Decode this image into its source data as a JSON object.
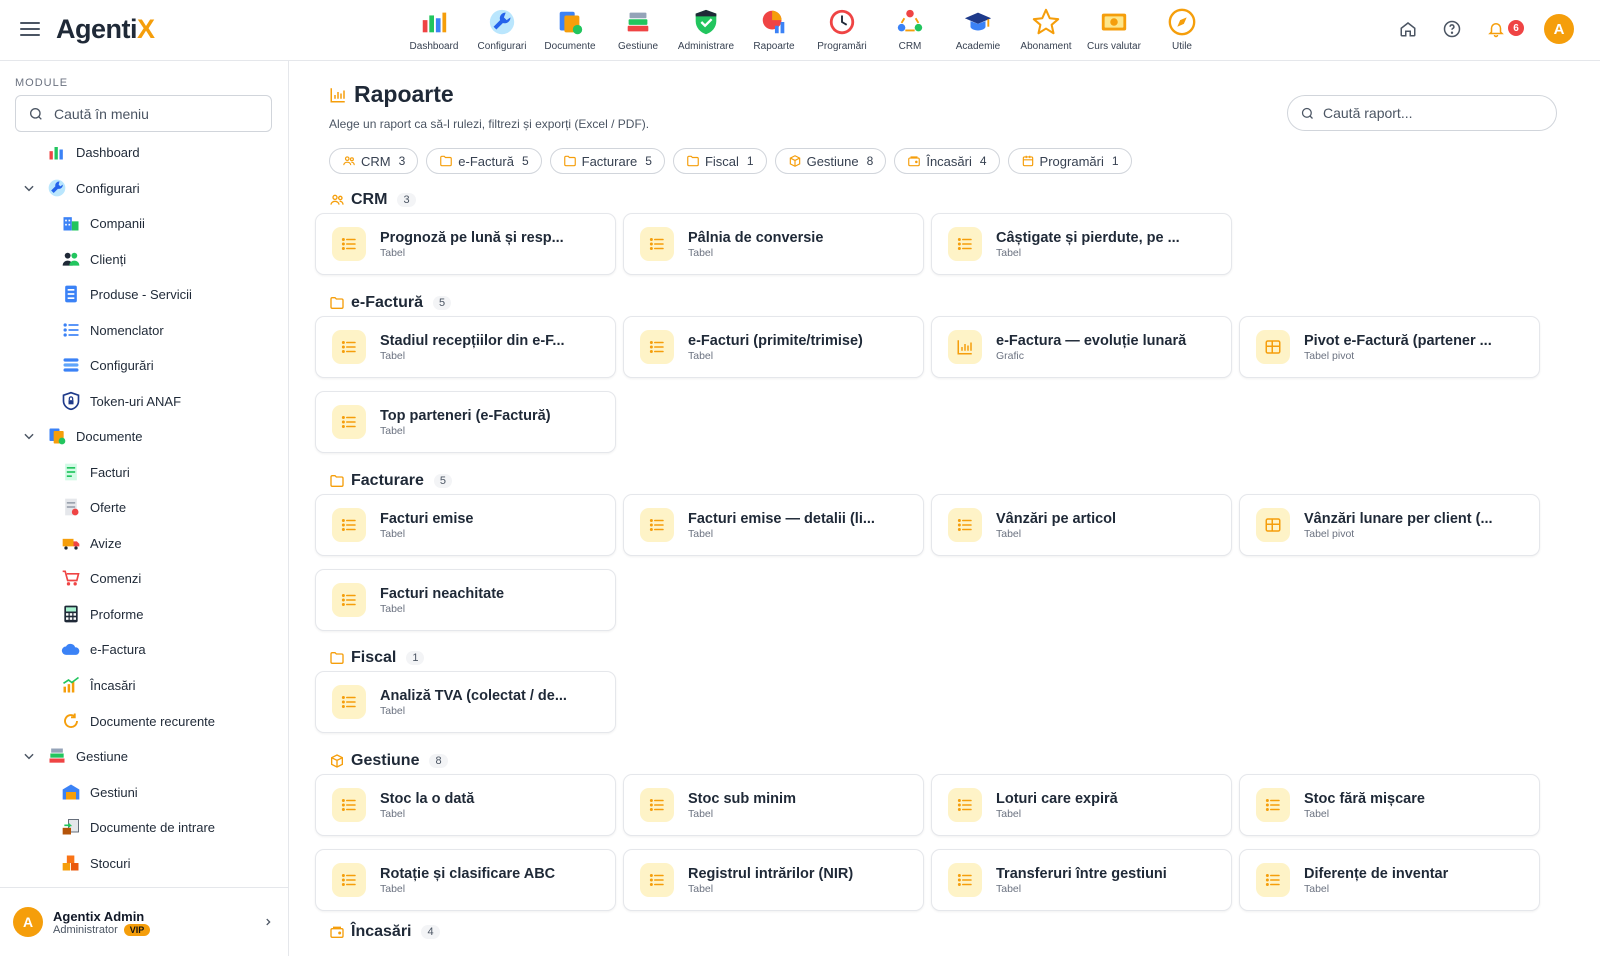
{
  "app": {
    "logo_main": "Agenti",
    "logo_accent": "X"
  },
  "topnav": [
    {
      "label": "Dashboard",
      "icon": "dashboard-icon"
    },
    {
      "label": "Configurari",
      "icon": "wrench-icon"
    },
    {
      "label": "Documente",
      "icon": "documents-icon"
    },
    {
      "label": "Gestiune",
      "icon": "books-icon"
    },
    {
      "label": "Administrare",
      "icon": "shield-icon"
    },
    {
      "label": "Rapoarte",
      "icon": "report-pie-icon"
    },
    {
      "label": "Programări",
      "icon": "clock-icon"
    },
    {
      "label": "CRM",
      "icon": "people-cycle-icon"
    },
    {
      "label": "Academie",
      "icon": "graduation-cap-icon"
    },
    {
      "label": "Abonament",
      "icon": "star-icon"
    },
    {
      "label": "Curs valutar",
      "icon": "money-icon"
    },
    {
      "label": "Utile",
      "icon": "compass-icon"
    }
  ],
  "header_right": {
    "notifications_count": "6",
    "avatar_letter": "A"
  },
  "sidebar": {
    "heading": "MODULE",
    "search_placeholder": "Caută în meniu",
    "items": [
      {
        "label": "Dashboard",
        "level": 0,
        "icon": "dashboard-icon"
      },
      {
        "label": "Configurari",
        "level": 0,
        "expanded": true,
        "icon": "wrench-icon"
      },
      {
        "label": "Companii",
        "level": 1,
        "icon": "building-icon"
      },
      {
        "label": "Clienți",
        "level": 1,
        "icon": "users-icon"
      },
      {
        "label": "Produse - Servicii",
        "level": 1,
        "icon": "product-list-icon"
      },
      {
        "label": "Nomenclator",
        "level": 1,
        "icon": "list-icon"
      },
      {
        "label": "Configurări",
        "level": 1,
        "icon": "settings-list-icon"
      },
      {
        "label": "Token-uri ANAF",
        "level": 1,
        "icon": "shield-lock-icon"
      },
      {
        "label": "Documente",
        "level": 0,
        "expanded": true,
        "icon": "documents-icon"
      },
      {
        "label": "Facturi",
        "level": 1,
        "icon": "invoice-icon"
      },
      {
        "label": "Oferte",
        "level": 1,
        "icon": "offer-icon"
      },
      {
        "label": "Avize",
        "level": 1,
        "icon": "truck-icon"
      },
      {
        "label": "Comenzi",
        "level": 1,
        "icon": "cart-icon"
      },
      {
        "label": "Proforme",
        "level": 1,
        "icon": "calculator-icon"
      },
      {
        "label": "e-Factura",
        "level": 1,
        "icon": "cloud-icon"
      },
      {
        "label": "Încasări",
        "level": 1,
        "icon": "chart-coins-icon"
      },
      {
        "label": "Documente recurente",
        "level": 1,
        "icon": "recurring-icon"
      },
      {
        "label": "Gestiune",
        "level": 0,
        "expanded": true,
        "icon": "books-icon"
      },
      {
        "label": "Gestiuni",
        "level": 1,
        "icon": "warehouse-icon"
      },
      {
        "label": "Documente de intrare",
        "level": 1,
        "icon": "inbound-icon"
      },
      {
        "label": "Stocuri",
        "level": 1,
        "icon": "boxes-icon"
      }
    ],
    "user": {
      "name": "Agentix Admin",
      "role": "Administrator",
      "badge": "VIP",
      "avatar_letter": "A"
    }
  },
  "page": {
    "title": "Rapoarte",
    "subtitle": "Alege un raport ca să-l rulezi, filtrezi și exporți (Excel / PDF).",
    "search_placeholder": "Caută raport..."
  },
  "chips": [
    {
      "label": "CRM",
      "count": "3",
      "icon": "people-icon"
    },
    {
      "label": "e-Factură",
      "count": "5",
      "icon": "folder-icon"
    },
    {
      "label": "Facturare",
      "count": "5",
      "icon": "folder-icon"
    },
    {
      "label": "Fiscal",
      "count": "1",
      "icon": "folder-icon"
    },
    {
      "label": "Gestiune",
      "count": "8",
      "icon": "box-icon"
    },
    {
      "label": "Încasări",
      "count": "4",
      "icon": "wallet-icon"
    },
    {
      "label": "Programări",
      "count": "1",
      "icon": "calendar-icon"
    }
  ],
  "sections": [
    {
      "title": "CRM",
      "count": "3",
      "icon": "people-icon",
      "cards": [
        {
          "title": "Prognoză pe lună și resp...",
          "kind": "Tabel",
          "icon": "list-icon"
        },
        {
          "title": "Pâlnia de conversie",
          "kind": "Tabel",
          "icon": "list-icon"
        },
        {
          "title": "Câștigate și pierdute, pe ...",
          "kind": "Tabel",
          "icon": "list-icon"
        }
      ]
    },
    {
      "title": "e-Factură",
      "count": "5",
      "icon": "folder-icon",
      "cards": [
        {
          "title": "Stadiul recepțiilor din e-F...",
          "kind": "Tabel",
          "icon": "list-icon"
        },
        {
          "title": "e-Facturi (primite/trimise)",
          "kind": "Tabel",
          "icon": "list-icon"
        },
        {
          "title": "e-Factura — evoluție lunară",
          "kind": "Grafic",
          "icon": "bar-chart-icon"
        },
        {
          "title": "Pivot e-Factură (partener ...",
          "kind": "Tabel pivot",
          "icon": "grid-icon"
        },
        {
          "title": "Top parteneri (e-Factură)",
          "kind": "Tabel",
          "icon": "list-icon"
        }
      ]
    },
    {
      "title": "Facturare",
      "count": "5",
      "icon": "folder-icon",
      "cards": [
        {
          "title": "Facturi emise",
          "kind": "Tabel",
          "icon": "list-icon"
        },
        {
          "title": "Facturi emise — detalii (li...",
          "kind": "Tabel",
          "icon": "list-icon"
        },
        {
          "title": "Vânzări pe articol",
          "kind": "Tabel",
          "icon": "list-icon"
        },
        {
          "title": "Vânzări lunare per client (...",
          "kind": "Tabel pivot",
          "icon": "grid-icon"
        },
        {
          "title": "Facturi neachitate",
          "kind": "Tabel",
          "icon": "list-icon"
        }
      ]
    },
    {
      "title": "Fiscal",
      "count": "1",
      "icon": "folder-icon",
      "cards": [
        {
          "title": "Analiză TVA (colectat / de...",
          "kind": "Tabel",
          "icon": "list-icon"
        }
      ]
    },
    {
      "title": "Gestiune",
      "count": "8",
      "icon": "box-icon",
      "cards": [
        {
          "title": "Stoc la o dată",
          "kind": "Tabel",
          "icon": "list-icon"
        },
        {
          "title": "Stoc sub minim",
          "kind": "Tabel",
          "icon": "list-icon"
        },
        {
          "title": "Loturi care expiră",
          "kind": "Tabel",
          "icon": "list-icon"
        },
        {
          "title": "Stoc fără mișcare",
          "kind": "Tabel",
          "icon": "list-icon"
        },
        {
          "title": "Rotație și clasificare ABC",
          "kind": "Tabel",
          "icon": "list-icon"
        },
        {
          "title": "Registrul intrărilor (NIR)",
          "kind": "Tabel",
          "icon": "list-icon"
        },
        {
          "title": "Transferuri între gestiuni",
          "kind": "Tabel",
          "icon": "list-icon"
        },
        {
          "title": "Diferențe de inventar",
          "kind": "Tabel",
          "icon": "list-icon"
        }
      ]
    },
    {
      "title": "Încasări",
      "count": "4",
      "icon": "wallet-icon",
      "cards": []
    }
  ]
}
